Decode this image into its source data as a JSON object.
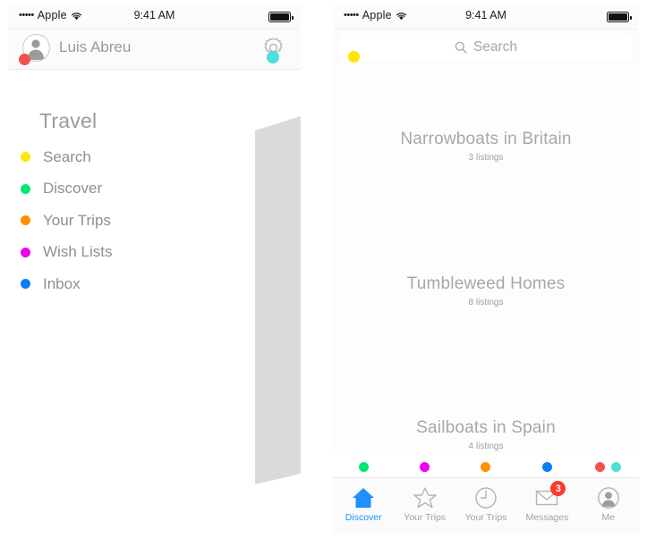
{
  "status_bar": {
    "signal_dots": "•••••",
    "carrier": "Apple",
    "wifi_icon": "wifi-icon",
    "time": "9:41 AM",
    "battery_icon": "battery-full-icon"
  },
  "left_screen": {
    "account": {
      "avatar_icon": "user-avatar-icon",
      "name": "Luis Abreu",
      "settings_icon": "gear-icon",
      "avatar_dot_color": "#F0534E",
      "settings_dot_color": "#4DE0D8"
    },
    "menu": {
      "title": "Travel",
      "items": [
        {
          "label": "Search",
          "dot_color": "#FFE800"
        },
        {
          "label": "Discover",
          "dot_color": "#00E96E"
        },
        {
          "label": "Your Trips",
          "dot_color": "#FF9000"
        },
        {
          "label": "Wish Lists",
          "dot_color": "#EE00EE"
        },
        {
          "label": "Inbox",
          "dot_color": "#0A7EF5"
        }
      ]
    }
  },
  "right_screen": {
    "search": {
      "icon": "search-icon",
      "placeholder": "Search",
      "dot_color": "#FFE800"
    },
    "listings": [
      {
        "title": "Narrowboats in Britain",
        "subtitle": "3 listings"
      },
      {
        "title": "Tumbleweed Homes",
        "subtitle": "8 listings"
      },
      {
        "title": "Sailboats in Spain",
        "subtitle": "4 listings"
      }
    ],
    "tabs": [
      {
        "label": "Discover",
        "icon": "home-icon",
        "active": true,
        "dots": [
          "#00E96E"
        ]
      },
      {
        "label": "Your Trips",
        "icon": "star-icon",
        "active": false,
        "dots": [
          "#EE00EE"
        ]
      },
      {
        "label": "Your Trips",
        "icon": "clock-icon",
        "active": false,
        "dots": [
          "#FF9000"
        ]
      },
      {
        "label": "Messages",
        "icon": "envelope-icon",
        "active": false,
        "dots": [
          "#0A7EF5"
        ],
        "badge": "3"
      },
      {
        "label": "Me",
        "icon": "person-icon",
        "active": false,
        "dots": [
          "#F0534E",
          "#4DE0D8"
        ]
      }
    ],
    "active_tab_color": "#1E90FF",
    "badge_color": "#FC3B2D"
  },
  "transition": {
    "curl_color": "#DADADA"
  }
}
